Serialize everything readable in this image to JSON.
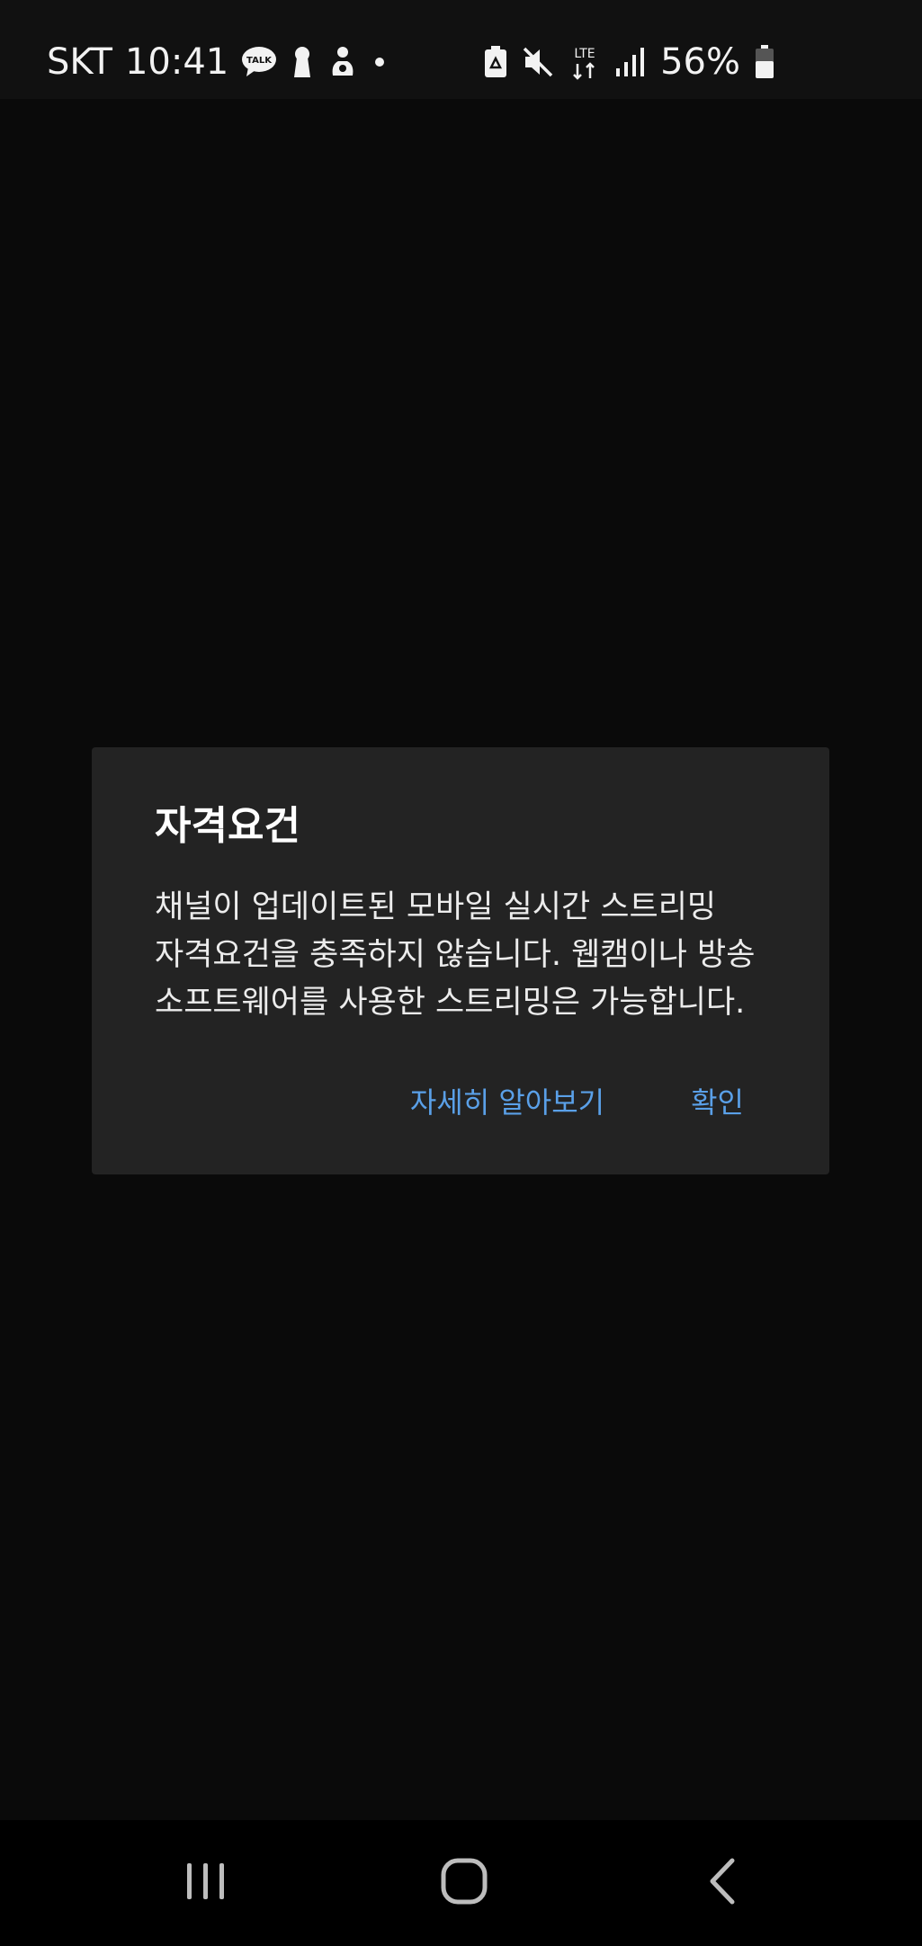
{
  "status_bar": {
    "carrier": "SKT",
    "time": "10:41",
    "talk_badge": "TALK",
    "network": "LTE",
    "battery_percent": "56%",
    "left_icons": [
      "kakaotalk-icon",
      "keyhole-icon",
      "baby-icon",
      "dot-icon"
    ],
    "right_icons": [
      "battery-saver-icon",
      "mute-icon",
      "lte-icon",
      "signal-icon",
      "battery-icon"
    ]
  },
  "dialog": {
    "title": "자격요건",
    "body_lines": [
      "채널이 업데이트된 모바일 실시간 스트리밍",
      "자격요건을 충족하지 않습니다. 웹캠이나 방송",
      "소프트웨어를 사용한 스트리밍은 가능합니다."
    ],
    "learn_more_label": "자세히 알아보기",
    "ok_label": "확인"
  },
  "nav_bar": {
    "icons": [
      "recent-apps-icon",
      "home-icon",
      "back-icon"
    ]
  },
  "colors": {
    "background": "#0a0a0a",
    "dialog_background": "#232323",
    "accent": "#5aa0e8"
  }
}
